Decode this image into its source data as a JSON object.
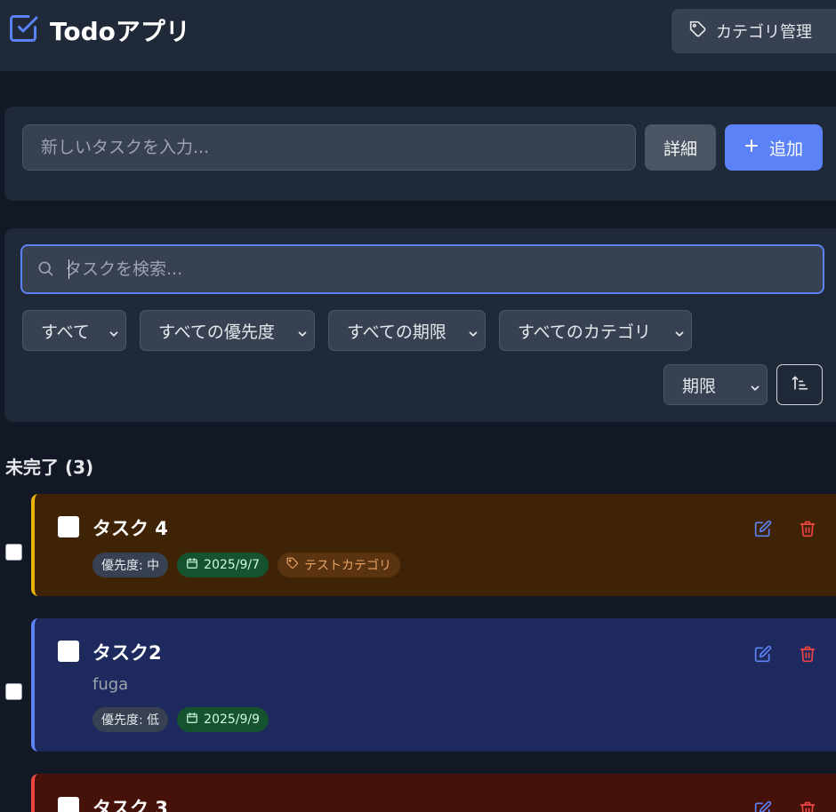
{
  "header": {
    "title": "Todoアプリ",
    "category_button": "カテゴリ管理"
  },
  "add_form": {
    "placeholder": "新しいタスクを入力...",
    "detail_button": "詳細",
    "add_button": "追加"
  },
  "filters": {
    "search_placeholder": "タスクを検索...",
    "status": "すべて",
    "priority": "すべての優先度",
    "due": "すべての期限",
    "category": "すべてのカテゴリ",
    "sort": "期限"
  },
  "section": {
    "title": "未完了 (3)"
  },
  "tasks": [
    {
      "title": "タスク 4",
      "priority": "優先度: 中",
      "due": "2025/9/7",
      "category": "テストカテゴリ"
    },
    {
      "title": "タスク2",
      "description": "fuga",
      "priority": "優先度: 低",
      "due": "2025/9/9"
    },
    {
      "title": "タスク 3"
    }
  ],
  "colors": {
    "accent": "#5b82f6",
    "medium_priority_bg": "#3f2306",
    "medium_priority_border": "#eab308",
    "low_priority_bg": "#1e2a5e",
    "low_priority_border": "#5b82f6",
    "high_priority_bg": "#451108",
    "high_priority_border": "#ef4444",
    "delete": "#ef4444"
  }
}
